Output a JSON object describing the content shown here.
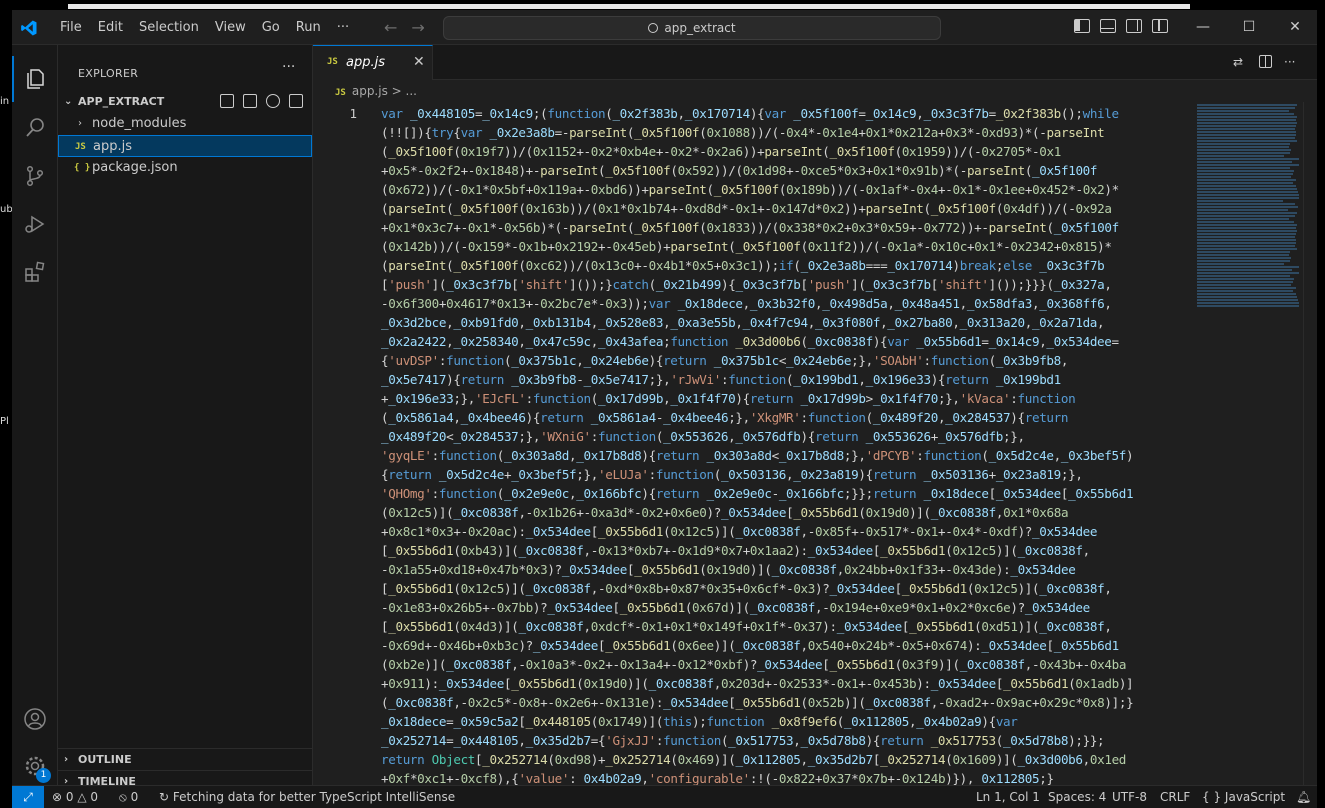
{
  "desktop": {
    "left_labels": [
      "in",
      "ub",
      "Pl"
    ]
  },
  "menu": [
    "File",
    "Edit",
    "Selection",
    "View",
    "Go",
    "Run",
    "···"
  ],
  "title": "app_extract",
  "window_controls": {
    "minimize": "—",
    "maximize": "☐",
    "close": "✕"
  },
  "sidebar": {
    "title": "EXPLORER",
    "more": "···",
    "folder": "APP_EXTRACT",
    "items": [
      {
        "label": "node_modules",
        "type": "folder"
      },
      {
        "label": "app.js",
        "type": "js",
        "icon": "JS"
      },
      {
        "label": "package.json",
        "type": "json",
        "icon": "{ }"
      }
    ],
    "outline": "OUTLINE",
    "timeline": "TIMELINE"
  },
  "activity": {
    "badge": "1"
  },
  "tab": {
    "label": "app.js",
    "icon": "JS",
    "close": "✕"
  },
  "breadcrumbs": {
    "file": "app.js",
    "rest": "> ..."
  },
  "editor": {
    "line_number": "1",
    "lines": [
      "var _0x448105=_0x14c9;(function(_0x2f383b,_0x170714){var _0x5f100f=_0x14c9,_0x3c3f7b=_0x2f383b();while",
      "(!![]){try{var _0x2e3a8b=-parseInt(_0x5f100f(0x1088))/(-0x4*-0x1e4+0x1*0x212a+0x3*-0xd93)*(-parseInt",
      "(_0x5f100f(0x19f7))/(0x1152+-0x2*0xb4e+-0x2*-0x2a6))+parseInt(_0x5f100f(0x1959))/(-0x2705*-0x1",
      "+0x5*-0x2f2+-0x1848)+-parseInt(_0x5f100f(0x592))/(0x1d98+-0xce5*0x3+0x1*0x91b)*(-parseInt(_0x5f100f",
      "(0x672))/(-0x1*0x5bf+0x119a+-0xbd6))+parseInt(_0x5f100f(0x189b))/(-0x1af*-0x4+-0x1*-0x1ee+0x452*-0x2)*",
      "(parseInt(_0x5f100f(0x163b))/(0x1*0x1b74+-0xd8d*-0x1+-0x147d*0x2))+parseInt(_0x5f100f(0x4df))/(-0x92a",
      "+0x1*0x3c7+-0x1*-0x56b)*(-parseInt(_0x5f100f(0x1833))/(0x338*0x2+0x3*0x59+-0x772))+-parseInt(_0x5f100f",
      "(0x142b))/(-0x159*-0x1b+0x2192+-0x45eb)+parseInt(_0x5f100f(0x11f2))/(-0x1a*-0x10c+0x1*-0x2342+0x815)*",
      "(parseInt(_0x5f100f(0xc62))/(0x13c0+-0x4b1*0x5+0x3c1));if(_0x2e3a8b===_0x170714)break;else _0x3c3f7b",
      "['push'](_0x3c3f7b['shift']());}catch(_0x21b499){_0x3c3f7b['push'](_0x3c3f7b['shift']());}}}(_0x327a,",
      "-0x6f300+0x4617*0x13+-0x2bc7e*-0x3));var _0x18dece,_0x3b32f0,_0x498d5a,_0x48a451,_0x58dfa3,_0x368ff6,",
      "_0x3d2bce,_0xb91fd0,_0xb131b4,_0x528e83,_0xa3e55b,_0x4f7c94,_0x3f080f,_0x27ba80,_0x313a20,_0x2a71da,",
      "_0x2a2422,_0x258340,_0x47c59c,_0x43afea;function _0x3d00b6(_0xc0838f){var _0x55b6d1=_0x14c9,_0x534dee=",
      "{'uvDSP':function(_0x375b1c,_0x24eb6e){return _0x375b1c<_0x24eb6e;},'SOAbH':function(_0x3b9fb8,",
      "_0x5e7417){return _0x3b9fb8-_0x5e7417;},'rJwVi':function(_0x199bd1,_0x196e33){return _0x199bd1",
      "+_0x196e33;},'EJcFL':function(_0x17d99b,_0x1f4f70){return _0x17d99b>_0x1f4f70;},'kVaca':function",
      "(_0x5861a4,_0x4bee46){return _0x5861a4-_0x4bee46;},'XkgMR':function(_0x489f20,_0x284537){return",
      "_0x489f20<_0x284537;},'WXniG':function(_0x553626,_0x576dfb){return _0x553626+_0x576dfb;},",
      "'gyqLE':function(_0x303a8d,_0x17b8d8){return _0x303a8d<_0x17b8d8;},'dPCYB':function(_0x5d2c4e,_0x3bef5f)",
      "{return _0x5d2c4e+_0x3bef5f;},'eLUJa':function(_0x503136,_0x23a819){return _0x503136+_0x23a819;},",
      "'QHOmg':function(_0x2e9e0c,_0x166bfc){return _0x2e9e0c-_0x166bfc;}};return _0x18dece[_0x534dee[_0x55b6d1",
      "(0x12c5)](_0xc0838f,-0x1b26+-0xa3d*-0x2+0x6e0)?_0x534dee[_0x55b6d1(0x19d0)](_0xc0838f,0x1*0x68a",
      "+0x8c1*0x3+-0x20ac):_0x534dee[_0x55b6d1(0x12c5)](_0xc0838f,-0x85f+-0x517*-0x1+-0x4*-0xdf)?_0x534dee",
      "[_0x55b6d1(0xb43)](_0xc0838f,-0x13*0xb7+-0x1d9*0x7+0x1aa2):_0x534dee[_0x55b6d1(0x12c5)](_0xc0838f,",
      "-0x1a55+0xd18+0x47b*0x3)?_0x534dee[_0x55b6d1(0x19d0)](_0xc0838f,0x24bb+0x1f33+-0x43de):_0x534dee",
      "[_0x55b6d1(0x12c5)](_0xc0838f,-0xd*0x8b+0x87*0x35+0x6cf*-0x3)?_0x534dee[_0x55b6d1(0x12c5)](_0xc0838f,",
      "-0x1e83+0x26b5+-0x7bb)?_0x534dee[_0x55b6d1(0x67d)](_0xc0838f,-0x194e+0xe9*0x1+0x2*0xc6e)?_0x534dee",
      "[_0x55b6d1(0x4d3)](_0xc0838f,0xdcf*-0x1+0x1*0x149f+0x1f*-0x37):_0x534dee[_0x55b6d1(0xd51)](_0xc0838f,",
      "-0x69d+-0x46b+0xb3c)?_0x534dee[_0x55b6d1(0x6ee)](_0xc0838f,0x540+0x24b*-0x5+0x674):_0x534dee[_0x55b6d1",
      "(0xb2e)](_0xc0838f,-0x10a3*-0x2+-0x13a4+-0x12*0xbf)?_0x534dee[_0x55b6d1(0x3f9)](_0xc0838f,-0x43b+-0x4ba",
      "+0x911):_0x534dee[_0x55b6d1(0x19d0)](_0xc0838f,0x203d+-0x2533*-0x1+-0x453b):_0x534dee[_0x55b6d1(0x1adb)]",
      "(_0xc0838f,-0x2c5*-0x8+-0x2e6+-0x131e):_0x534dee[_0x55b6d1(0x52b)](_0xc0838f,-0xad2+-0x9ac+0x29c*0x8)];}",
      "_0x18dece=_0x59c5a2[_0x448105(0x1749)](this);function _0x8f9ef6(_0x112805,_0x4b02a9){var",
      "_0x252714=_0x448105,_0x35d2b7={'GjxJJ':function(_0x517753,_0x5d78b8){return _0x517753(_0x5d78b8);}};",
      "return Object[_0x252714(0xd98)+_0x252714(0x469)](_0x112805,_0x35d2b7[_0x252714(0x1609)](_0x3d00b6,0x1ed",
      "+0xf*0xc1+-0xcf8),{'value':_0x4b02a9,'configurable':!(-0x822+0x37*0x7b+-0x124b)}),_0x112805;}"
    ]
  },
  "statusbar": {
    "errors": "0",
    "warnings": "0",
    "ports": "0",
    "message": "Fetching data for better TypeScript IntelliSense",
    "position": "Ln 1, Col 1",
    "spaces": "Spaces: 4",
    "encoding": "UTF-8",
    "eol": "CRLF",
    "language_icon": "{ }",
    "language": "JavaScript"
  },
  "colors": {
    "accent": "#0078d4",
    "js_icon": "#cbcb41",
    "variable": "#9cdcfe",
    "string": "#ce9178",
    "keyword": "#569cd6",
    "function": "#dcdcaa",
    "number": "#b5cea8"
  }
}
